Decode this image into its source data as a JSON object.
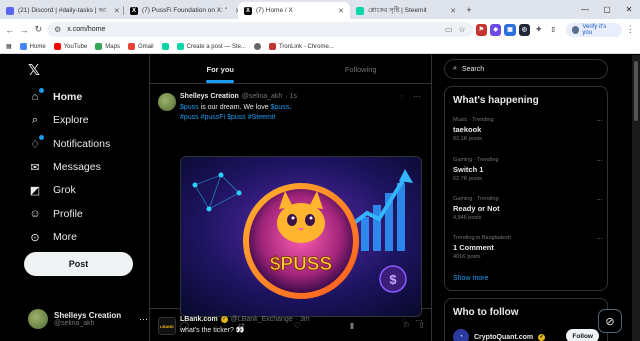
{
  "browser": {
    "tabs": [
      {
        "title": "(21) Discord | #daily-tasks | আ",
        "color": "#5865f2",
        "active": false
      },
      {
        "title": "(7) PussFi Foundation on X: \"",
        "color": "#000000",
        "active": false
      },
      {
        "title": "(7) Home / X",
        "color": "#000000",
        "active": true
      },
      {
        "title": "শ্লোকের সৃষ্টি | Steemit",
        "color": "#06d6a9",
        "active": false
      }
    ],
    "new_tab": "+",
    "url": "x.com/home",
    "verify_label": "Verify it's you",
    "bookmarks": [
      {
        "label": "Home",
        "color": "#4285f4"
      },
      {
        "label": "YouTube",
        "color": "#ff0000"
      },
      {
        "label": "Maps",
        "color": "#34a853"
      },
      {
        "label": "Gmail",
        "color": "#ea4335"
      },
      {
        "label": "",
        "color": "#06d6a9"
      },
      {
        "label": "Create a post — Ste...",
        "color": "#06d6a9"
      },
      {
        "label": "",
        "color": "#666666"
      },
      {
        "label": "TronLink - Chrome...",
        "color": "#c23631"
      }
    ]
  },
  "nav": {
    "items": [
      {
        "label": "Home",
        "icon": "home-icon",
        "glyph": "⌂"
      },
      {
        "label": "Explore",
        "icon": "search-icon",
        "glyph": "⌕"
      },
      {
        "label": "Notifications",
        "icon": "bell-icon",
        "glyph": "♢"
      },
      {
        "label": "Messages",
        "icon": "mail-icon",
        "glyph": "✉"
      },
      {
        "label": "Grok",
        "icon": "grok-icon",
        "glyph": "◩"
      },
      {
        "label": "Profile",
        "icon": "person-icon",
        "glyph": "☺"
      },
      {
        "label": "More",
        "icon": "more-icon",
        "glyph": "⋯"
      }
    ],
    "post_label": "Post",
    "account_name": "Shelleys Creation",
    "account_handle": "@selina_akh"
  },
  "feed": {
    "tabs": [
      "For you",
      "Following"
    ],
    "tweet1": {
      "name": "Shelleys Creation",
      "handle": "@selina_akh",
      "time": "· 1s",
      "text_prefix": "$puss",
      "text_rest": " is our dream. We love ",
      "text_tag1": "$puss",
      "text_end": ".",
      "line2": "#puss #pussFi $puss #Steemit",
      "image_caption": "$PUSS"
    },
    "tweet2": {
      "avatar_text": "LBANK",
      "name": "LBank.com",
      "handle": "@LBank_Exchange",
      "time": "· 3m",
      "text": "what's the ticker? 👀"
    }
  },
  "right": {
    "search_placeholder": "Search",
    "happening_title": "What's happening",
    "trends": [
      {
        "category": "Music · Trending",
        "title": "taekook",
        "posts": "82.1K posts"
      },
      {
        "category": "Gaming · Trending",
        "title": "Switch 1",
        "posts": "62.7K posts"
      },
      {
        "category": "Gaming · Trending",
        "title": "Ready or Not",
        "posts": "4,846 posts"
      },
      {
        "category": "Trending in Bangladesh",
        "title": "1 Comment",
        "posts": "401K posts"
      }
    ],
    "show_more": "Show more",
    "follow_title": "Who to follow",
    "follow_name": "CryptoQuant.com",
    "follow_button": "Follow"
  }
}
